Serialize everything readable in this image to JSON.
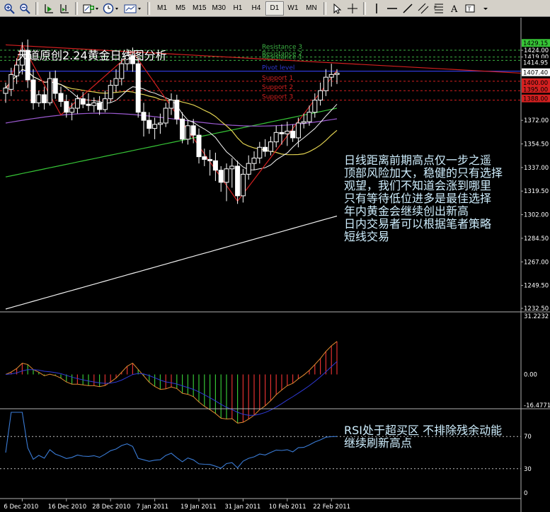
{
  "toolbar": {
    "timeframes": [
      "M1",
      "M5",
      "M15",
      "M30",
      "H1",
      "H4",
      "D1",
      "W1",
      "MN"
    ],
    "active_timeframe": "D1"
  },
  "chart": {
    "title": "天道原创2.24黄金日线图分析",
    "levels": [
      {
        "label": "Resistance 3",
        "value": 1424.0,
        "color": "#3cb043"
      },
      {
        "label": "Resistance 2",
        "value": 1419.0,
        "color": "#3cb043"
      },
      {
        "label": "Resistance 1",
        "value": 1416.5,
        "color": "#3cb043"
      },
      {
        "label": "Pivot level",
        "value": 1408.5,
        "color": "#2f3ad6"
      },
      {
        "label": "Support 1",
        "value": 1401.0,
        "color": "#d42020"
      },
      {
        "label": "Support 2",
        "value": 1394.0,
        "color": "#d42020"
      },
      {
        "label": "Support 3",
        "value": 1387.0,
        "color": "#d42020"
      }
    ],
    "price_axis_labels": [
      "1429.15",
      "1424.00",
      "1419.00",
      "1414.95",
      "1407.40",
      "1400.00",
      "1395.00",
      "1388.00",
      "1372.00",
      "1354.50",
      "1337.00",
      "1319.50",
      "1302.00",
      "1284.50",
      "1267.00",
      "1249.50",
      "1232.50"
    ],
    "current_price": "1407.40",
    "annotation_lines": [
      "日线距离前期高点仅一步之遥",
      "顶部风险加大，稳健的只有选择",
      "观望，我们不知道会涨到哪里",
      "只有等待低位进多是最佳选择",
      "年内黄金会继续创出新高",
      "日内交易者可以根据笔者策略",
      "短线交易"
    ]
  },
  "macd": {
    "axis_labels": [
      "31.2232",
      "0.00",
      "-16.4771"
    ]
  },
  "rsi": {
    "axis_labels": [
      "70",
      "30",
      "0"
    ],
    "annotation_lines": [
      "RSI处于超买区 不排除残余动能",
      "继续刷新高点"
    ]
  },
  "time_axis": {
    "labels": [
      "6 Dec 2010",
      "16 Dec 2010",
      "28 Dec 2010",
      "7 Jan 2011",
      "19 Jan 2011",
      "31 Jan 2011",
      "10 Feb 2011",
      "22 Feb 2011"
    ]
  },
  "chart_data": {
    "type": "candlestick",
    "ylim": [
      1232.5,
      1434.0
    ],
    "x": [
      "2010-12-01",
      "2010-12-02",
      "2010-12-03",
      "2010-12-06",
      "2010-12-07",
      "2010-12-08",
      "2010-12-09",
      "2010-12-10",
      "2010-12-13",
      "2010-12-14",
      "2010-12-15",
      "2010-12-16",
      "2010-12-17",
      "2010-12-20",
      "2010-12-21",
      "2010-12-22",
      "2010-12-23",
      "2010-12-24",
      "2010-12-27",
      "2010-12-28",
      "2010-12-29",
      "2010-12-30",
      "2010-12-31",
      "2011-01-03",
      "2011-01-04",
      "2011-01-05",
      "2011-01-06",
      "2011-01-07",
      "2011-01-10",
      "2011-01-11",
      "2011-01-12",
      "2011-01-13",
      "2011-01-14",
      "2011-01-17",
      "2011-01-18",
      "2011-01-19",
      "2011-01-20",
      "2011-01-21",
      "2011-01-24",
      "2011-01-25",
      "2011-01-26",
      "2011-01-27",
      "2011-01-28",
      "2011-01-31",
      "2011-02-01",
      "2011-02-02",
      "2011-02-03",
      "2011-02-04",
      "2011-02-07",
      "2011-02-08",
      "2011-02-09",
      "2011-02-10",
      "2011-02-11",
      "2011-02-14",
      "2011-02-15",
      "2011-02-16",
      "2011-02-17",
      "2011-02-18",
      "2011-02-21",
      "2011-02-22",
      "2011-02-23"
    ],
    "open": [
      1392,
      1395,
      1405,
      1413,
      1424,
      1402,
      1385,
      1391,
      1385,
      1403,
      1392,
      1386,
      1378,
      1381,
      1388,
      1384,
      1383,
      1385,
      1380,
      1388,
      1398,
      1403,
      1414,
      1420,
      1414,
      1378,
      1372,
      1366,
      1369,
      1370,
      1381,
      1387,
      1373,
      1358,
      1368,
      1361,
      1345,
      1343,
      1342,
      1335,
      1326,
      1336,
      1338,
      1316,
      1332,
      1340,
      1344,
      1352,
      1349,
      1356,
      1363,
      1362,
      1364,
      1359,
      1370,
      1371,
      1378,
      1387,
      1394,
      1404,
      1406
    ],
    "high": [
      1400,
      1411,
      1418,
      1430,
      1432,
      1410,
      1394,
      1397,
      1408,
      1409,
      1397,
      1391,
      1385,
      1391,
      1393,
      1392,
      1389,
      1390,
      1394,
      1402,
      1410,
      1418,
      1425,
      1426,
      1418,
      1385,
      1378,
      1374,
      1377,
      1385,
      1392,
      1391,
      1378,
      1372,
      1373,
      1366,
      1351,
      1350,
      1348,
      1338,
      1340,
      1344,
      1342,
      1336,
      1346,
      1349,
      1356,
      1358,
      1360,
      1368,
      1369,
      1371,
      1369,
      1374,
      1377,
      1383,
      1392,
      1400,
      1410,
      1414,
      1410
    ],
    "low": [
      1385,
      1390,
      1399,
      1406,
      1396,
      1380,
      1382,
      1380,
      1383,
      1388,
      1382,
      1374,
      1372,
      1377,
      1381,
      1379,
      1378,
      1376,
      1378,
      1385,
      1393,
      1398,
      1409,
      1408,
      1374,
      1360,
      1362,
      1358,
      1362,
      1367,
      1376,
      1369,
      1355,
      1354,
      1355,
      1340,
      1338,
      1331,
      1327,
      1319,
      1312,
      1322,
      1310,
      1311,
      1328,
      1335,
      1340,
      1345,
      1346,
      1352,
      1354,
      1353,
      1356,
      1352,
      1366,
      1368,
      1374,
      1383,
      1390,
      1397,
      1399
    ],
    "close": [
      1396,
      1406,
      1413,
      1424,
      1402,
      1385,
      1391,
      1385,
      1403,
      1392,
      1386,
      1378,
      1381,
      1388,
      1384,
      1383,
      1385,
      1380,
      1388,
      1398,
      1403,
      1414,
      1420,
      1414,
      1378,
      1372,
      1366,
      1369,
      1370,
      1381,
      1387,
      1373,
      1358,
      1368,
      1361,
      1345,
      1343,
      1342,
      1335,
      1326,
      1336,
      1338,
      1316,
      1332,
      1340,
      1344,
      1352,
      1349,
      1356,
      1363,
      1362,
      1364,
      1359,
      1370,
      1371,
      1378,
      1387,
      1394,
      1404,
      1406,
      1407
    ]
  }
}
